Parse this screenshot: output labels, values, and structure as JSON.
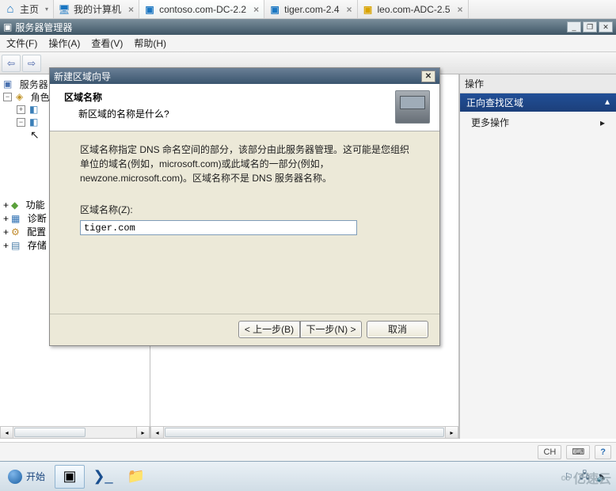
{
  "tabs": {
    "home": "主页",
    "mypc": "我的计算机",
    "t2": "contoso.com-DC-2.2",
    "t3": "tiger.com-2.4",
    "t4": "leo.com-ADC-2.5"
  },
  "title": "服务器管理器",
  "menu": {
    "file": "文件(F)",
    "action": "操作(A)",
    "view": "查看(V)",
    "help": "帮助(H)"
  },
  "tree": {
    "root": "服务器",
    "roles": "角色",
    "fn": "功能",
    "diag": "诊断",
    "cfg": "配置",
    "store": "存储"
  },
  "actions": {
    "header": "操作",
    "zone": "正向查找区域",
    "more": "更多操作"
  },
  "wizard": {
    "title": "新建区域向导",
    "head": "区域名称",
    "sub": "新区域的名称是什么?",
    "desc": "区域名称指定 DNS 命名空间的部分，该部分由此服务器管理。这可能是您组织单位的域名(例如，microsoft.com)或此域名的一部分(例如，newzone.microsoft.com)。区域名称不是 DNS 服务器名称。",
    "label": "区域名称(Z):",
    "value": "tiger.com",
    "back": "< 上一步(B)",
    "next": "下一步(N) >",
    "cancel": "取消"
  },
  "status": {
    "ch": "CH"
  },
  "task": {
    "start": "开始"
  },
  "watermark": "亿速云"
}
